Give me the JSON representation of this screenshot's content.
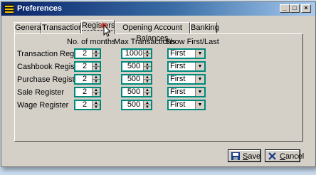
{
  "window": {
    "title": "Preferences"
  },
  "titlebar_buttons": {
    "minimize": "_",
    "maximize": "□",
    "close": "×"
  },
  "tabs": [
    {
      "label": "General"
    },
    {
      "label": "Transactions"
    },
    {
      "label": "Registers",
      "active": true
    },
    {
      "label": "Opening Account Balances"
    },
    {
      "label": "Banking"
    }
  ],
  "columns": {
    "months": "No. of months",
    "max_transactions": "Max Transactions",
    "show": "Show First/Last"
  },
  "registers": [
    {
      "name": "Transaction Register",
      "months": "2",
      "max": "1000",
      "show": "First"
    },
    {
      "name": "Cashbook Register",
      "months": "2",
      "max": "500",
      "show": "First"
    },
    {
      "name": "Purchase Register",
      "months": "2",
      "max": "500",
      "show": "First"
    },
    {
      "name": "Sale Register",
      "months": "2",
      "max": "500",
      "show": "First"
    },
    {
      "name": "Wage Register",
      "months": "2",
      "max": "500",
      "show": "First"
    }
  ],
  "buttons": {
    "save_label": "Save",
    "save_key": "S",
    "save_rest": "ave",
    "cancel_label": "Cancel",
    "cancel_key": "C",
    "cancel_rest": "ancel"
  },
  "colors": {
    "field_border": "#00897b",
    "title_start": "#0a246a",
    "title_end": "#a6caf0"
  }
}
